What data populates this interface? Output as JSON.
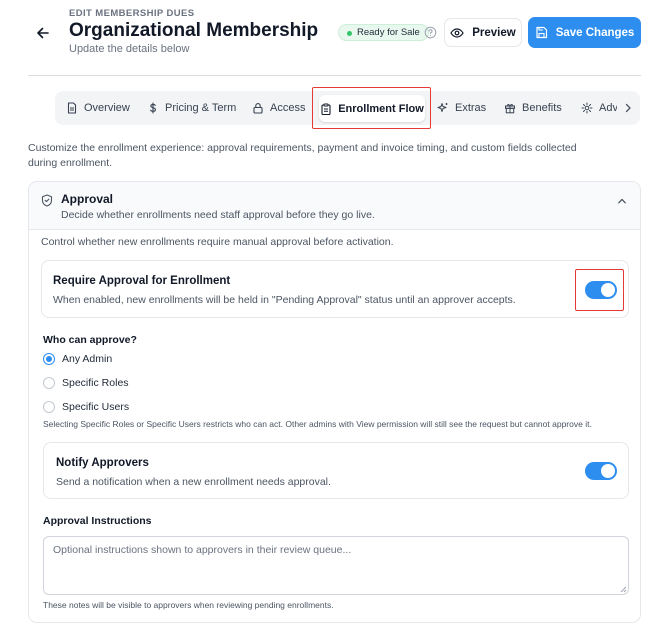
{
  "header": {
    "eyebrow": "EDIT MEMBERSHIP DUES",
    "title": "Organizational Membership",
    "subtitle": "Update the details below",
    "status_badge": "Ready for Sale",
    "preview_label": "Preview",
    "save_label": "Save Changes"
  },
  "tabs": {
    "items": [
      {
        "label": "Overview",
        "icon": "document-icon"
      },
      {
        "label": "Pricing & Term",
        "icon": "dollar-icon"
      },
      {
        "label": "Access",
        "icon": "lock-icon"
      },
      {
        "label": "Enrollment Flow",
        "icon": "clipboard-icon",
        "active": true
      },
      {
        "label": "Extras",
        "icon": "sparkle-icon"
      },
      {
        "label": "Benefits",
        "icon": "gift-icon"
      },
      {
        "label": "Adv",
        "icon": "gear-icon"
      }
    ]
  },
  "intro": "Customize the enrollment experience: approval requirements, payment and invoice timing, and custom fields collected during enrollment.",
  "approval": {
    "title": "Approval",
    "subtitle": "Decide whether enrollments need staff approval before they go live.",
    "control_text": "Control whether new enrollments require manual approval before activation.",
    "require": {
      "title": "Require Approval for Enrollment",
      "description": "When enabled, new enrollments will be held in \"Pending Approval\" status until an approver accepts.",
      "enabled": true
    },
    "who_label": "Who can approve?",
    "options": [
      "Any Admin",
      "Specific Roles",
      "Specific Users"
    ],
    "selected_option": "Any Admin",
    "who_note": "Selecting Specific Roles or Specific Users restricts who can act. Other admins with View permission will still see the request but cannot approve it.",
    "notify": {
      "title": "Notify Approvers",
      "description": "Send a notification when a new enrollment needs approval.",
      "enabled": true
    },
    "instructions_label": "Approval Instructions",
    "instructions_placeholder": "Optional instructions shown to approvers in their review queue...",
    "instructions_value": "",
    "instructions_note": "These notes will be visible to approvers when reviewing pending enrollments."
  },
  "colors": {
    "accent": "#2e8ef0",
    "highlight": "#e53935",
    "status_dot": "#34c46b"
  }
}
